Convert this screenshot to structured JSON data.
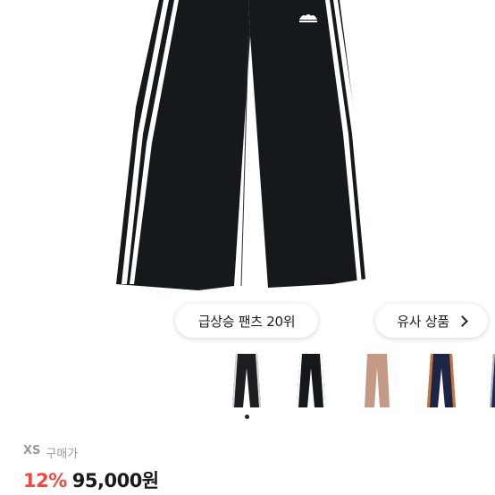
{
  "product": {
    "image_icon": "black-track-pants-with-white-stripes",
    "rank_badge": "급상승 팬츠 20위",
    "similar_button": "유사 상품",
    "size": "XS",
    "purchase_label": "구매가",
    "discount": "12%",
    "price": "95,000원",
    "accent_color": "#f4483e"
  },
  "thumbnails": [
    {
      "icon": "black-pants-thumbnail",
      "color": "#1c1f22",
      "stripe": "#d8d8d8"
    },
    {
      "icon": "black-pants-thumbnail",
      "color": "#15181a",
      "stripe": "#ffffff"
    },
    {
      "icon": "brown-pants-thumbnail",
      "color": "#c49a86",
      "stripe": "#e9d4c9"
    },
    {
      "icon": "navy-pants-thumbnail",
      "color": "#1d2547",
      "stripe": "#c8763a"
    },
    {
      "icon": "navy-pants-thumbnail",
      "color": "#1d2a5a",
      "stripe": "#b0b6c8"
    }
  ]
}
